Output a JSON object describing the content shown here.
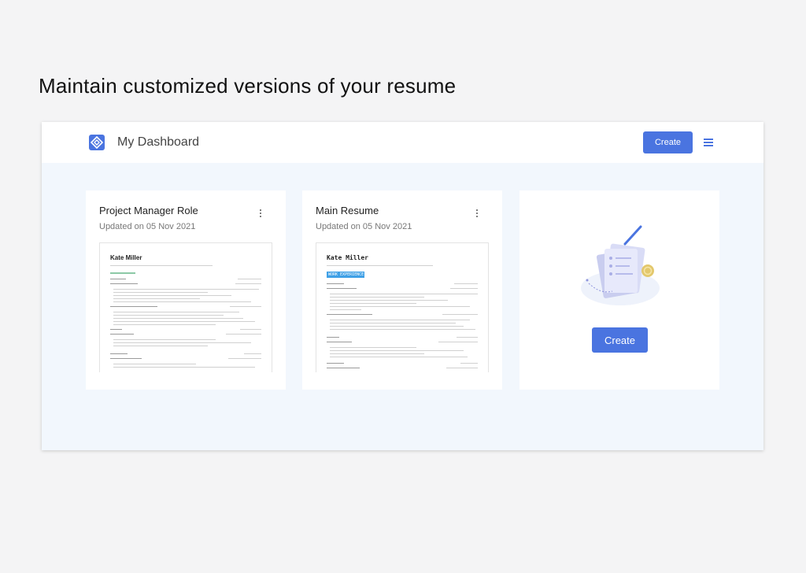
{
  "headline": "Maintain customized versions of your resume",
  "header": {
    "logo_icon": "diamond-logo-icon",
    "title": "My Dashboard",
    "create_label": "Create",
    "menu_icon": "hamburger-menu-icon"
  },
  "cards": [
    {
      "title": "Project Manager Role",
      "updated": "Updated on 05 Nov 2021",
      "preview_name": "Kate Miller"
    },
    {
      "title": "Main Resume",
      "updated": "Updated on 05 Nov 2021",
      "preview_name": "Kate Miller",
      "preview_section": "WORK EXPERIENCE"
    }
  ],
  "create_card": {
    "create_label": "Create",
    "illustration": "documents-illustration-icon"
  },
  "colors": {
    "accent": "#4a74e0",
    "page_bg": "#f4f4f5",
    "dashboard_bg": "#f2f7fd",
    "chip": "#3fa0e6"
  }
}
